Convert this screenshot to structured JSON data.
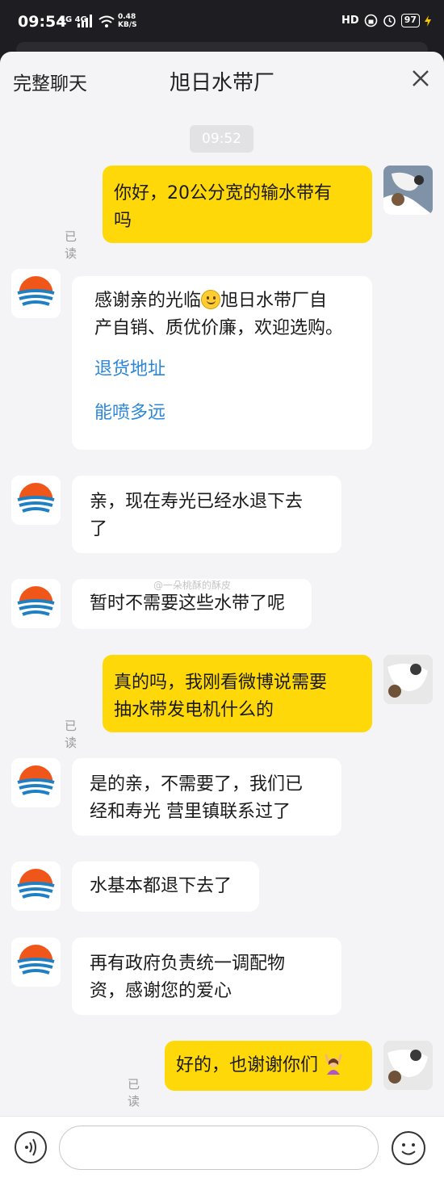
{
  "status_bar": {
    "time": "09:54",
    "network": "4G 4G",
    "speed_value": "0.48",
    "speed_unit": "KB/S",
    "hd_label": "HD",
    "battery": "97"
  },
  "header": {
    "left_label": "完整聊天",
    "title": "旭日水带厂"
  },
  "chat": {
    "timestamp": "09:52",
    "read_label": "已读",
    "messages": [
      {
        "from": "me",
        "line1": "你好，20公分宽的输水带有",
        "line2": "吗"
      },
      {
        "from": "shop",
        "line1_a": "感谢亲的光临",
        "line1_b": "旭日水带厂自",
        "line2": "产自销、质优价廉，欢迎选购。",
        "links": [
          "退货地址",
          "能喷多远"
        ]
      },
      {
        "from": "shop",
        "line1": "亲，现在寿光已经水退下去",
        "line2": "了"
      },
      {
        "from": "shop",
        "line1": "暂时不需要这些水带了呢"
      },
      {
        "from": "me",
        "line1": "真的吗，我刚看微博说需要",
        "line2": "抽水带发电机什么的"
      },
      {
        "from": "shop",
        "line1": "是的亲，不需要了，我们已",
        "line2": "经和寿光 营里镇联系过了"
      },
      {
        "from": "shop",
        "line1": "水基本都退下去了"
      },
      {
        "from": "shop",
        "line1": "再有政府负责统一调配物",
        "line2": "资，感谢您的爱心"
      },
      {
        "from": "me",
        "line1": "好的，也谢谢你们"
      }
    ],
    "watermark": "@一朵桃酥的酥皮"
  },
  "icons": {
    "close": "close-icon",
    "voice": "voice-icon",
    "emoji": "emoji-icon"
  },
  "colors": {
    "my_bubble": "#ffd80a",
    "link": "#2b87d9",
    "sheet_bg": "#f4f4f6"
  }
}
